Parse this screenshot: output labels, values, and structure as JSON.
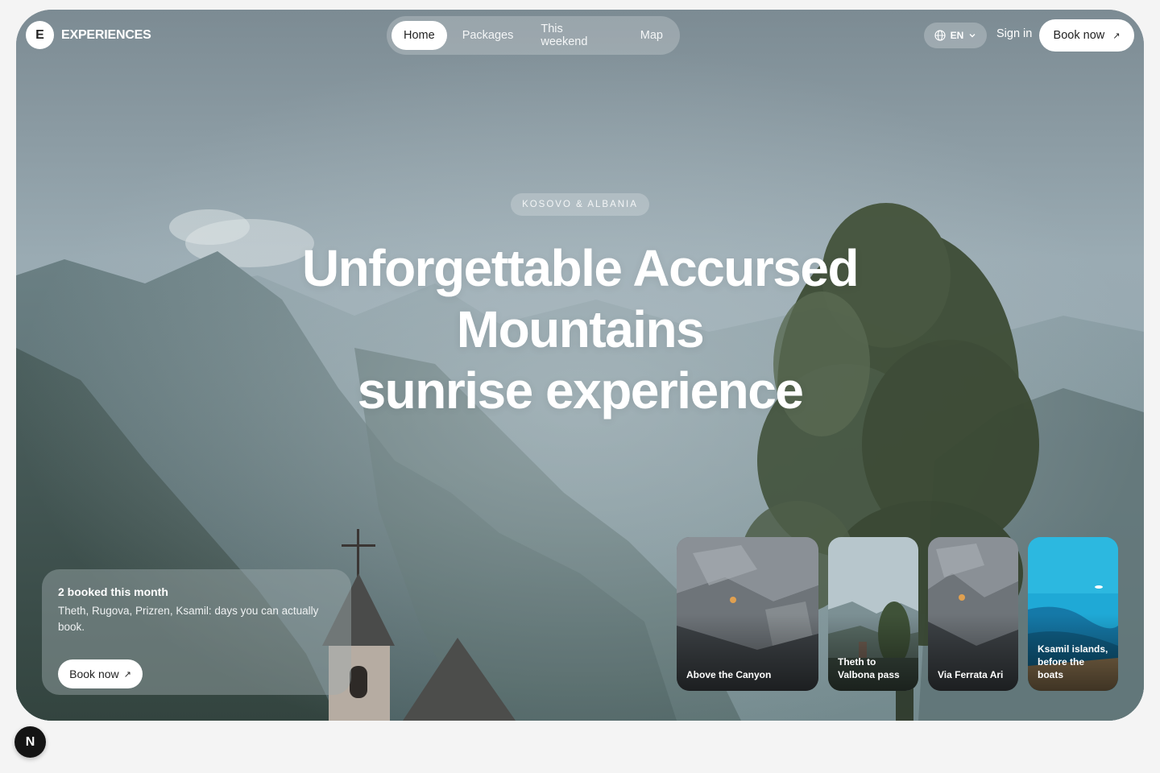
{
  "brand": {
    "mark": "E",
    "name": "EXPERIENCES"
  },
  "nav": {
    "items": [
      {
        "label": "Home",
        "active": true
      },
      {
        "label": "Packages",
        "active": false
      },
      {
        "label": "This weekend",
        "active": false
      },
      {
        "label": "Map",
        "active": false
      }
    ]
  },
  "header": {
    "language": "EN",
    "sign_in": "Sign in",
    "book_label": "Book now",
    "book_arrow": "↗"
  },
  "hero": {
    "tag": "KOSOVO & ALBANIA",
    "headline": [
      "Unforgettable Accursed",
      "Mountains",
      "sunrise experience"
    ]
  },
  "promo": {
    "title": "2 booked this month",
    "description": "Theth, Rugova, Prizren, Ksamil: days you can actually book.",
    "button_label": "Book now",
    "button_arrow": "↗"
  },
  "experiences": [
    {
      "label": "Above the Canyon"
    },
    {
      "label": "Theth to Valbona pass"
    },
    {
      "label": "Via Ferrata Ari"
    },
    {
      "label": "Ksamil islands, before the boats"
    }
  ],
  "dev_badge": "N",
  "colors": {
    "accent": "#ffffff",
    "text_dark": "#222222",
    "page_bg": "#f4f4f4"
  }
}
